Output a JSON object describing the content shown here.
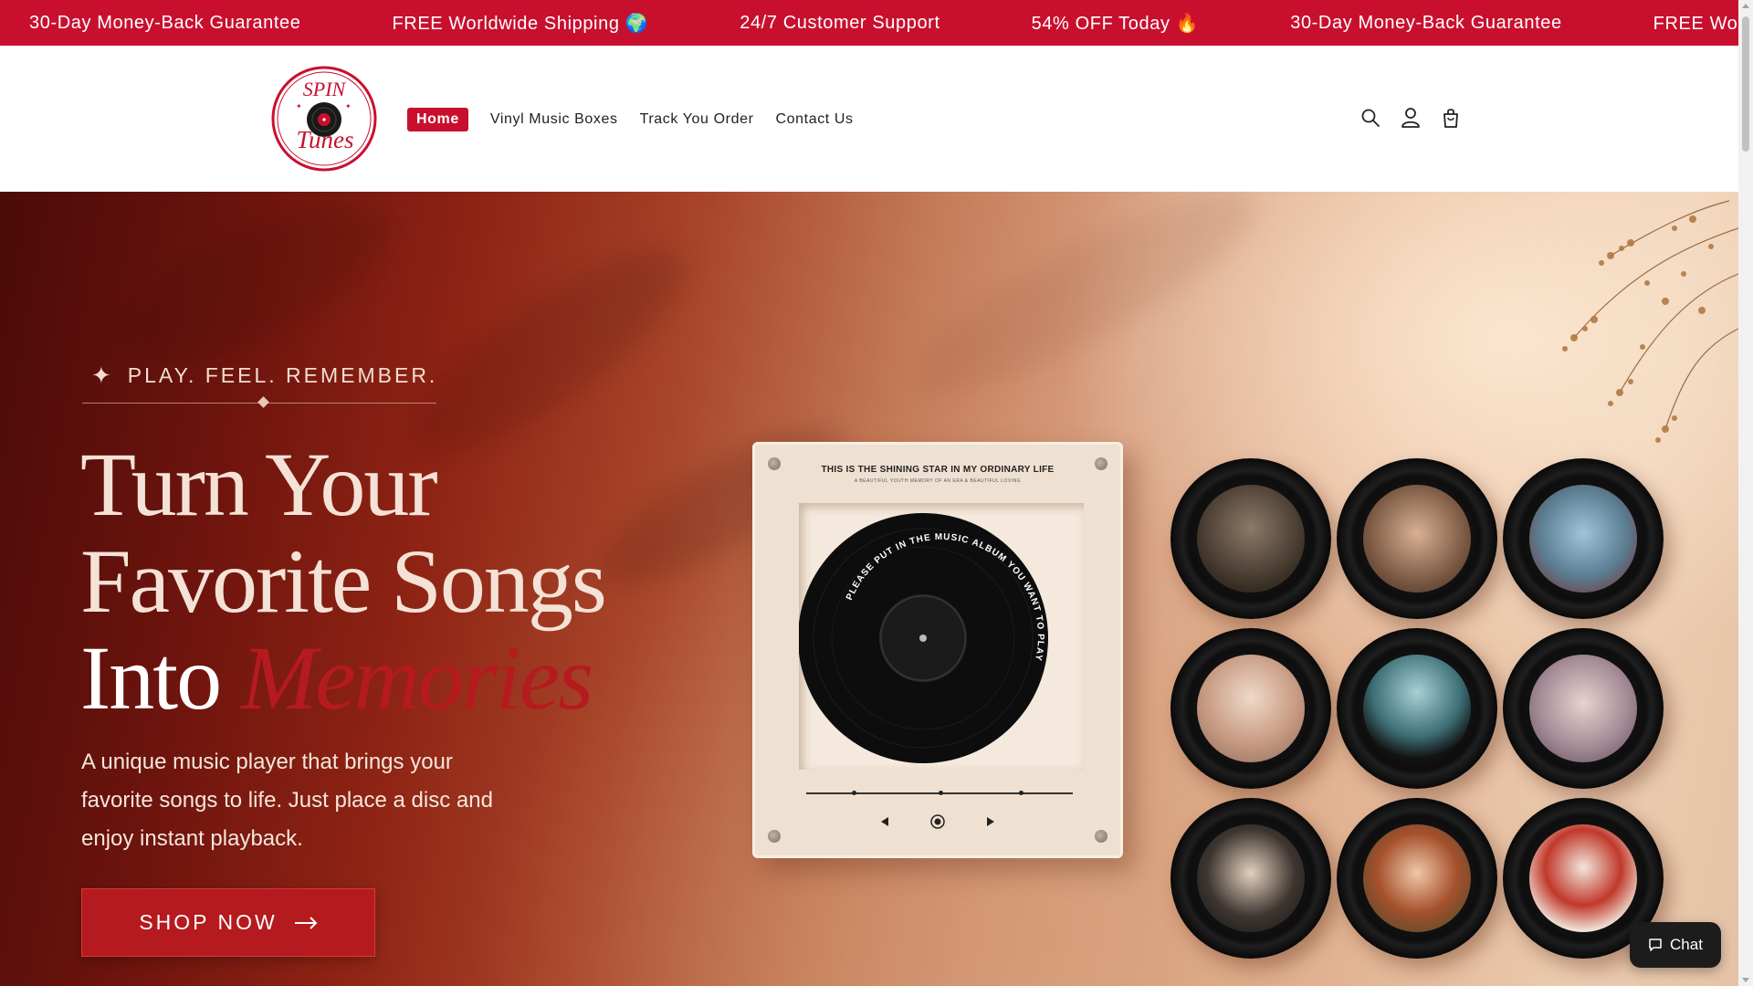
{
  "announcement": {
    "items": [
      "30-Day Money-Back Guarantee",
      "FREE Worldwide Shipping 🌍",
      "24/7 Customer Support",
      "54% OFF Today 🔥",
      "30-Day Money-Back Guarantee",
      "FREE Worldwide Shipping 🌍"
    ]
  },
  "header": {
    "logo": {
      "line1": "SPIN",
      "line2": "Tunes"
    },
    "nav": [
      {
        "label": "Home",
        "active": true
      },
      {
        "label": "Vinyl Music Boxes",
        "active": false
      },
      {
        "label": "Track You Order",
        "active": false
      },
      {
        "label": "Contact Us",
        "active": false
      }
    ],
    "icons": [
      "search-icon",
      "account-icon",
      "cart-icon"
    ]
  },
  "hero": {
    "tagline": "PLAY. FEEL. REMEMBER.",
    "headline": {
      "line1": "Turn Your",
      "line2": "Favorite Songs",
      "line3_prefix": "Into ",
      "line3_accent": "Memories"
    },
    "subtext": "A unique music player that brings your favorite songs to life. Just place a disc and enjoy instant playback.",
    "cta_label": "SHOP NOW",
    "colors": {
      "accent": "#c8102e",
      "button": "#b41a1e"
    }
  },
  "product": {
    "title": "THIS IS THE SHINING STAR IN MY ORDINARY LIFE",
    "subtitle": "A BEAUTIFUL YOUTH MEMORY OF AN ERA & BEAUTIFUL LOVING",
    "record_text": "PLEASE PUT IN THE MUSIC ALBUM YOU WANT TO PLAY"
  },
  "chat": {
    "label": "Chat"
  }
}
